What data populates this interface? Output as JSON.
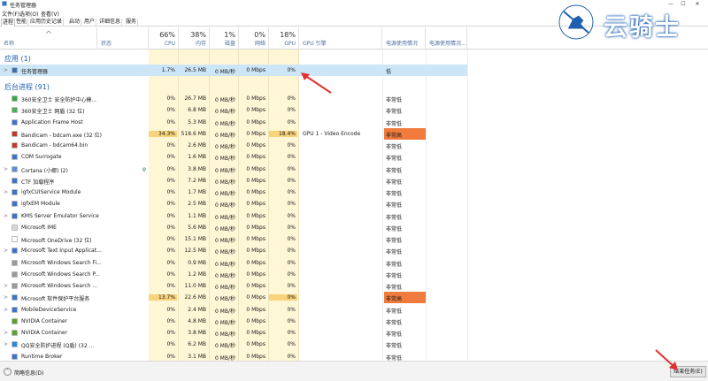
{
  "window": {
    "title": "任务管理器",
    "min": "—",
    "max": "☐",
    "close": "✕"
  },
  "menu": [
    "文件(F)",
    "选项(O)",
    "查看(V)"
  ],
  "tabs": [
    "进程",
    "性能",
    "应用历史记录",
    "启动",
    "用户",
    "详细信息",
    "服务"
  ],
  "header": {
    "name": "名称",
    "status": "状态",
    "cpu": {
      "pct": "66%",
      "label": "CPU"
    },
    "mem": {
      "pct": "38%",
      "label": "内存"
    },
    "disk": {
      "pct": "1%",
      "label": "磁盘"
    },
    "net": {
      "pct": "0%",
      "label": "网络"
    },
    "gpu": {
      "pct": "18%",
      "label": "GPU"
    },
    "gpu_engine": "GPU 引擎",
    "power": "电源使用情况",
    "power_trend": "电源使用情况..."
  },
  "sections": {
    "apps": "应用 (1)",
    "background": "后台进程 (91)"
  },
  "apps": [
    {
      "name": "任务管理器",
      "cpu": "1.7%",
      "mem": "26.5 MB",
      "disk": "0 MB/秒",
      "net": "0 Mbps",
      "gpu": "0%",
      "engine": "",
      "power": "低",
      "expand": ">"
    }
  ],
  "processes": [
    {
      "name": "360安全卫士 安全防护中心模...",
      "cpu": "0%",
      "mem": "26.7 MB",
      "disk": "0 MB/秒",
      "net": "0 Mbps",
      "gpu": "0%",
      "engine": "",
      "power": "非常低",
      "expand": "",
      "icon": "#3aa64a"
    },
    {
      "name": "360安全卫士 网盾 (32 位)",
      "cpu": "0%",
      "mem": "6.8 MB",
      "disk": "0 MB/秒",
      "net": "0 Mbps",
      "gpu": "0%",
      "engine": "",
      "power": "非常低",
      "expand": "",
      "icon": "#4caf50"
    },
    {
      "name": "Application Frame Host",
      "cpu": "0%",
      "mem": "5.3 MB",
      "disk": "0 MB/秒",
      "net": "0 Mbps",
      "gpu": "0%",
      "engine": "",
      "power": "非常低",
      "expand": "",
      "icon": "#3d74c9"
    },
    {
      "name": "Bandicam - bdcam.exe (32 位)",
      "cpu": "34.3%",
      "mem": "518.6 MB",
      "disk": "0 MB/秒",
      "net": "0 Mbps",
      "gpu": "18.4%",
      "engine": "GPU 1 - Video Encode",
      "power": "非常高",
      "expand": "",
      "icon": "#c0392b",
      "high": true
    },
    {
      "name": "Bandicam - bdcam64.bin",
      "cpu": "0%",
      "mem": "2.6 MB",
      "disk": "0 MB/秒",
      "net": "0 Mbps",
      "gpu": "0%",
      "engine": "",
      "power": "非常低",
      "expand": "",
      "icon": "#c0392b"
    },
    {
      "name": "COM Surrogate",
      "cpu": "0%",
      "mem": "1.6 MB",
      "disk": "0 MB/秒",
      "net": "0 Mbps",
      "gpu": "0%",
      "engine": "",
      "power": "非常低",
      "expand": "",
      "icon": "#3d74c9"
    },
    {
      "name": "Cortana (小娜) (2)",
      "cpu": "0%",
      "mem": "3.8 MB",
      "disk": "0 MB/秒",
      "net": "0 Mbps",
      "gpu": "0%",
      "engine": "",
      "power": "非常低",
      "expand": ">",
      "icon": "#5b8fd6",
      "leaf": "φ"
    },
    {
      "name": "CTF 加载程序",
      "cpu": "0%",
      "mem": "7.2 MB",
      "disk": "0 MB/秒",
      "net": "0 Mbps",
      "gpu": "0%",
      "engine": "",
      "power": "非常低",
      "expand": "",
      "icon": "#3d74c9"
    },
    {
      "name": "igfxCUIService Module",
      "cpu": "0%",
      "mem": "1.7 MB",
      "disk": "0 MB/秒",
      "net": "0 Mbps",
      "gpu": "0%",
      "engine": "",
      "power": "非常低",
      "expand": ">",
      "icon": "#3d74c9"
    },
    {
      "name": "igfxEM Module",
      "cpu": "0%",
      "mem": "2.5 MB",
      "disk": "0 MB/秒",
      "net": "0 Mbps",
      "gpu": "0%",
      "engine": "",
      "power": "非常低",
      "expand": "",
      "icon": "#3d74c9"
    },
    {
      "name": "KMS Server Emulator Service",
      "cpu": "0%",
      "mem": "1.1 MB",
      "disk": "0 MB/秒",
      "net": "0 Mbps",
      "gpu": "0%",
      "engine": "",
      "power": "非常低",
      "expand": ">",
      "icon": "#3d74c9"
    },
    {
      "name": "Microsoft IME",
      "cpu": "0%",
      "mem": "5.6 MB",
      "disk": "0 MB/秒",
      "net": "0 Mbps",
      "gpu": "0%",
      "engine": "",
      "power": "非常低",
      "expand": "",
      "icon": "#d8d8d8"
    },
    {
      "name": "Microsoft OneDrive (32 位)",
      "cpu": "0%",
      "mem": "15.1 MB",
      "disk": "0 MB/秒",
      "net": "0 Mbps",
      "gpu": "0%",
      "engine": "",
      "power": "非常低",
      "expand": "",
      "icon": "#ffffff"
    },
    {
      "name": "Microsoft Text Input Applicat...",
      "cpu": "0%",
      "mem": "12.5 MB",
      "disk": "0 MB/秒",
      "net": "0 Mbps",
      "gpu": "0%",
      "engine": "",
      "power": "非常低",
      "expand": ">",
      "icon": "#3d74c9"
    },
    {
      "name": "Microsoft Windows Search Fi...",
      "cpu": "0%",
      "mem": "0.9 MB",
      "disk": "0 MB/秒",
      "net": "0 Mbps",
      "gpu": "0%",
      "engine": "",
      "power": "非常低",
      "expand": "",
      "icon": "#9a9a9a"
    },
    {
      "name": "Microsoft Windows Search P...",
      "cpu": "0%",
      "mem": "1.2 MB",
      "disk": "0 MB/秒",
      "net": "0 Mbps",
      "gpu": "0%",
      "engine": "",
      "power": "非常低",
      "expand": "",
      "icon": "#9a9a9a"
    },
    {
      "name": "Microsoft Windows Search ...",
      "cpu": "0%",
      "mem": "11.0 MB",
      "disk": "0 MB/秒",
      "net": "0 Mbps",
      "gpu": "0%",
      "engine": "",
      "power": "非常低",
      "expand": ">",
      "icon": "#9a9a9a"
    },
    {
      "name": "Microsoft 软件保护平台服务",
      "cpu": "13.7%",
      "mem": "22.6 MB",
      "disk": "0 MB/秒",
      "net": "0 Mbps",
      "gpu": "0%",
      "engine": "",
      "power": "非常高",
      "expand": ">",
      "icon": "#3d74c9",
      "high": true
    },
    {
      "name": "MobileDeviceService",
      "cpu": "0%",
      "mem": "2.4 MB",
      "disk": "0 MB/秒",
      "net": "0 Mbps",
      "gpu": "0%",
      "engine": "",
      "power": "非常低",
      "expand": ">",
      "icon": "#3d74c9"
    },
    {
      "name": "NVIDIA Container",
      "cpu": "0%",
      "mem": "4.8 MB",
      "disk": "0 MB/秒",
      "net": "0 Mbps",
      "gpu": "0%",
      "engine": "",
      "power": "非常低",
      "expand": "",
      "icon": "#5aa02c"
    },
    {
      "name": "NVIDIA Container",
      "cpu": "0%",
      "mem": "3.8 MB",
      "disk": "0 MB/秒",
      "net": "0 Mbps",
      "gpu": "0%",
      "engine": "",
      "power": "非常低",
      "expand": ">",
      "icon": "#5aa02c"
    },
    {
      "name": "QQ安全防护进程 (Q盾) (32 ...",
      "cpu": "0%",
      "mem": "6.2 MB",
      "disk": "0 MB/秒",
      "net": "0 Mbps",
      "gpu": "0%",
      "engine": "",
      "power": "非常低",
      "expand": ">",
      "icon": "#2b8ad8"
    },
    {
      "name": "Runtime Broker",
      "cpu": "0%",
      "mem": "3.1 MB",
      "disk": "0 MB/秒",
      "net": "0 Mbps",
      "gpu": "0%",
      "engine": "",
      "power": "非常低",
      "expand": "",
      "icon": "#3d74c9"
    }
  ],
  "footer": {
    "less": "简略信息(D)",
    "end_task": "结束任务(E)"
  },
  "watermark": {
    "brand": "云骑士"
  },
  "colors": {
    "accent": "#1f5fb0",
    "heat_low": "#fff6d5",
    "heat_mid": "#f8d37a",
    "power_high": "#f07b3d",
    "selected": "#cde6f7",
    "annotation": "#e03131"
  }
}
